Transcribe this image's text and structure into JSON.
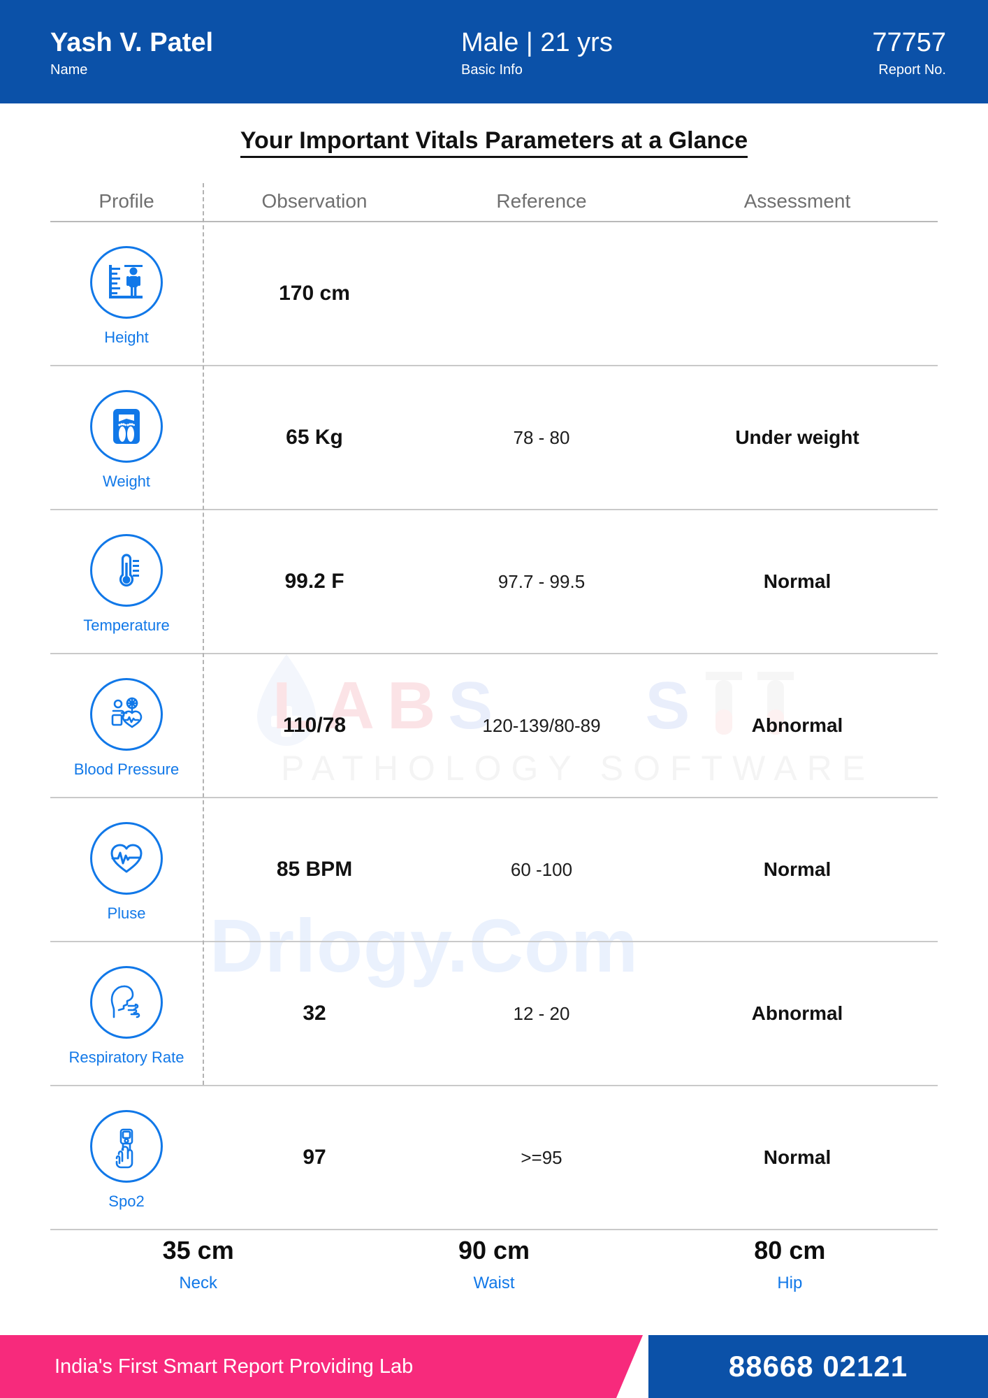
{
  "header": {
    "patient_name": "Yash V. Patel",
    "name_label": "Name",
    "basic_info": "Male | 21 yrs",
    "basic_info_label": "Basic Info",
    "report_no": "77757",
    "report_no_label": "Report No."
  },
  "page_title": "Your Important Vitals Parameters at a Glance",
  "columns": {
    "profile": "Profile",
    "observation": "Observation",
    "reference": "Reference",
    "assessment": "Assessment"
  },
  "rows": [
    {
      "icon": "height-ruler-icon",
      "label": "Height",
      "observation": "170 cm",
      "reference": "",
      "assessment": ""
    },
    {
      "icon": "weight-scale-icon",
      "label": "Weight",
      "observation": "65 Kg",
      "reference": "78 - 80",
      "assessment": "Under weight"
    },
    {
      "icon": "thermometer-icon",
      "label": "Temperature",
      "observation": "99.2  F",
      "reference": "97.7 - 99.5",
      "assessment": "Normal"
    },
    {
      "icon": "blood-pressure-monitor-icon",
      "label": "Blood Pressure",
      "observation": "110/78",
      "reference": "120-139/80-89",
      "assessment": "Abnormal"
    },
    {
      "icon": "heart-pulse-icon",
      "label": "Pluse",
      "observation": "85 BPM",
      "reference": "60 -100",
      "assessment": "Normal"
    },
    {
      "icon": "breathing-head-icon",
      "label": "Respiratory Rate",
      "observation": "32",
      "reference": "12 - 20",
      "assessment": "Abnormal"
    },
    {
      "icon": "pulse-oximeter-finger-icon",
      "label": "Spo2",
      "observation": "97",
      "reference": ">=95",
      "assessment": "Normal"
    }
  ],
  "measurements": [
    {
      "value": "35 cm",
      "label": "Neck"
    },
    {
      "value": "90 cm",
      "label": "Waist"
    },
    {
      "value": "80 cm",
      "label": "Hip"
    }
  ],
  "footer": {
    "tagline": "India's First Smart Report Providing Lab",
    "phone": "88668 02121"
  },
  "watermark": {
    "brand_lab": "LAB",
    "brand_s1": "S",
    "brand_s2": "S",
    "subtitle": "PATHOLOGY SOFTWARE",
    "site": "Drlogy.Com"
  },
  "colors": {
    "header_blue": "#0b51a8",
    "accent_blue": "#1178e8",
    "footer_pink": "#f72a7c",
    "rule_gray": "#c9c9c9",
    "header_text_gray": "#6f6f6f"
  }
}
